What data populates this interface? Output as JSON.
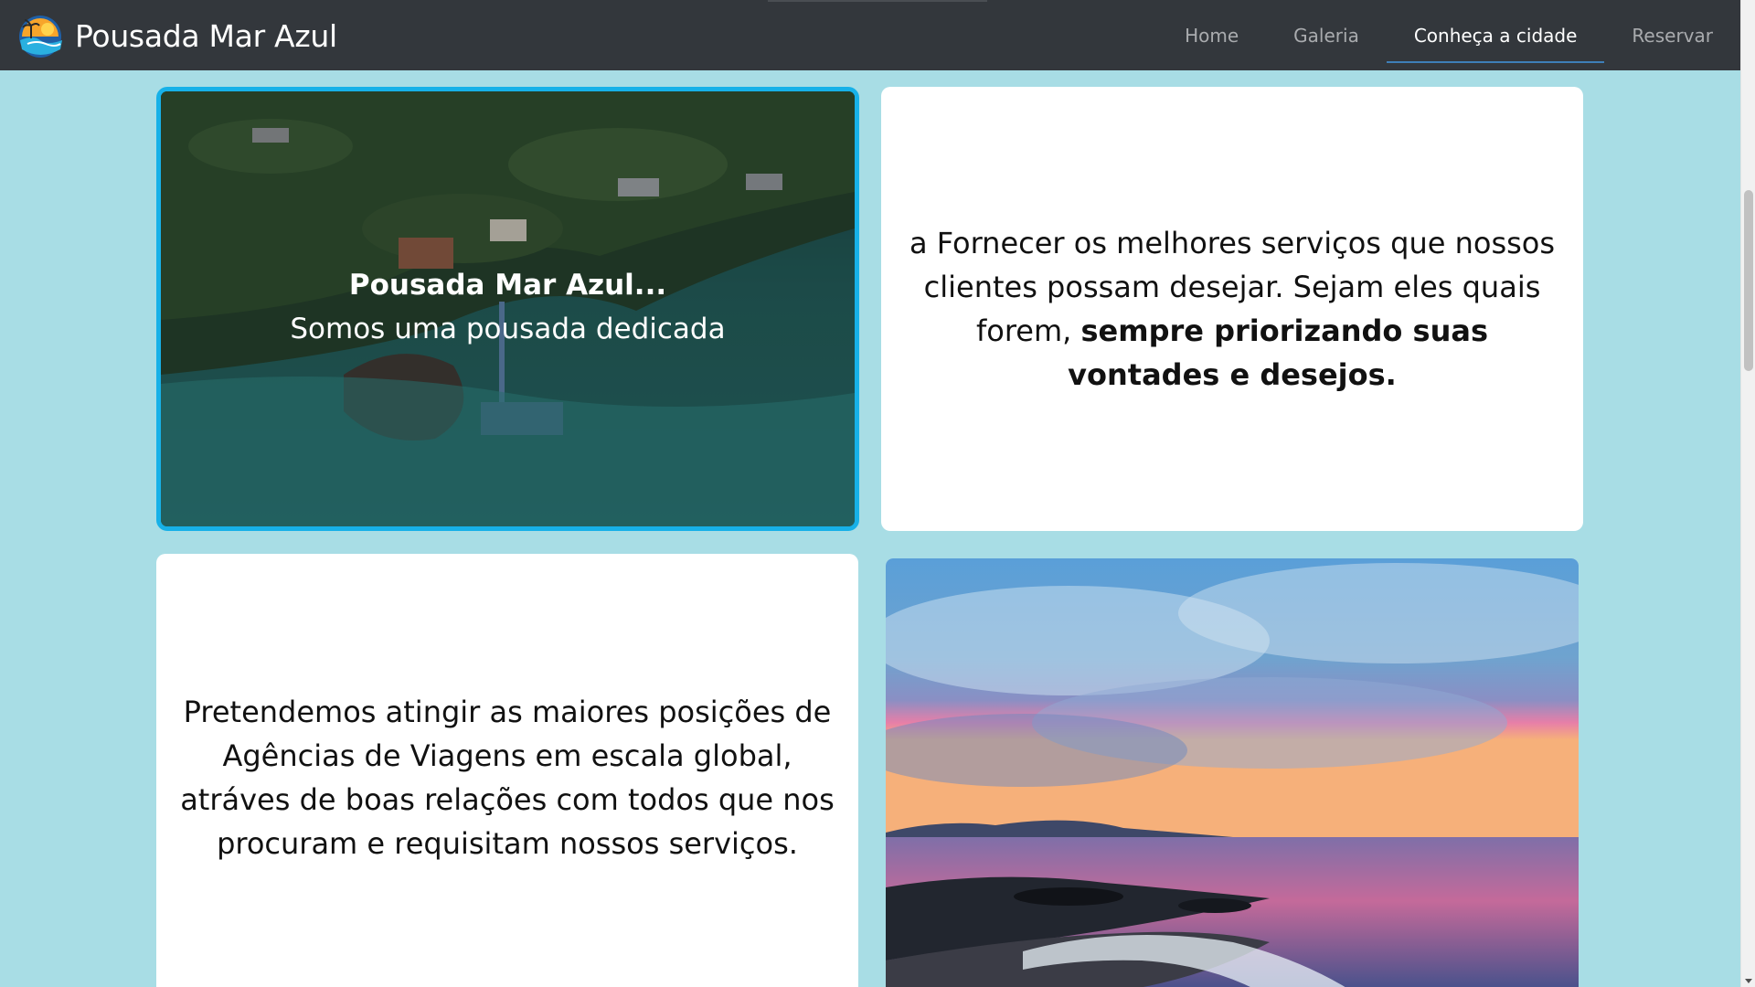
{
  "navbar": {
    "brand": "Pousada Mar Azul",
    "links": [
      {
        "label": "Home"
      },
      {
        "label": "Galeria"
      },
      {
        "label": "Conheça a cidade"
      },
      {
        "label": "Reservar"
      }
    ]
  },
  "hero": {
    "title": "Pousada Mar Azul...",
    "subtitle": "Somos uma pousada dedicada"
  },
  "mission": {
    "text": "a Fornecer os melhores serviços que nossos clientes possam desejar. Sejam eles quais forem, ",
    "emphasis": "sempre priorizando suas vontades e desejos."
  },
  "vision": {
    "text": "Pretendemos atingir as maiores posições de Agências de Viagens em escala global, atráves de boas relações com todos que nos procuram e requisitam nossos serviços."
  },
  "icons": {
    "logo": "sunset-beach-logo-icon",
    "scroll_down": "chevron-down-icon"
  },
  "colors": {
    "navbar_bg": "#33373c",
    "page_bg": "#a8dde5",
    "active_underline": "#3e7fb8",
    "hero_border": "#17b1e8"
  }
}
